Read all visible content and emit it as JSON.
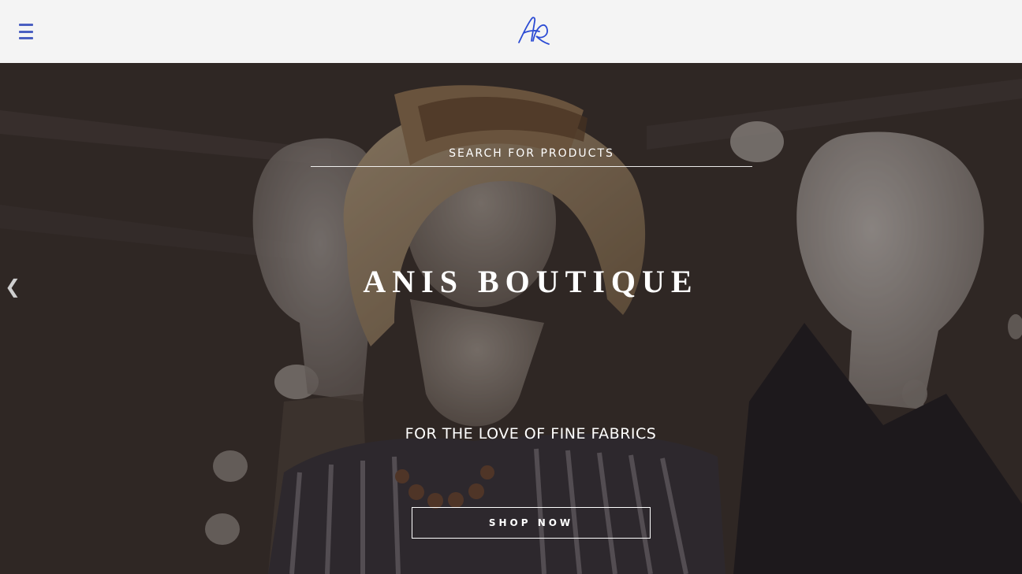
{
  "header": {
    "menu_icon": "hamburger-menu-icon",
    "logo_text": "AR",
    "accent_color": "#4a5fc1",
    "logo_color": "#2b4bd4"
  },
  "hero": {
    "search": {
      "placeholder": "SEARCH FOR PRODUCTS"
    },
    "title": "ANIS BOUTIQUE",
    "subtitle": "FOR THE LOVE OF FINE FABRICS",
    "cta_label": "SHOP NOW",
    "prev_arrow": "❮",
    "background_image": "mannequins-boutique-photo"
  }
}
